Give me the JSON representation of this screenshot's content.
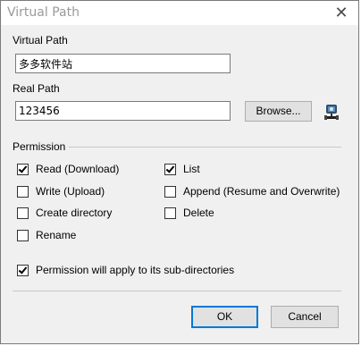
{
  "window": {
    "title": "Virtual Path",
    "close_glyph": "✕"
  },
  "virtual_path": {
    "label": "Virtual Path",
    "value": "多多软件站"
  },
  "real_path": {
    "label": "Real Path",
    "value": "123456",
    "browse_label": "Browse...",
    "browse_icon": "network-folder-icon"
  },
  "permission": {
    "group_label": "Permission",
    "read": {
      "label": "Read (Download)",
      "checked": true
    },
    "list": {
      "label": "List",
      "checked": true
    },
    "write": {
      "label": "Write (Upload)",
      "checked": false
    },
    "append": {
      "label": "Append (Resume and Overwrite)",
      "checked": false
    },
    "create_dir": {
      "label": "Create directory",
      "checked": false
    },
    "delete": {
      "label": "Delete",
      "checked": false
    },
    "rename": {
      "label": "Rename",
      "checked": false
    },
    "apply_subdirs": {
      "label": "Permission will apply to its sub-directories",
      "checked": true
    }
  },
  "buttons": {
    "ok": "OK",
    "cancel": "Cancel"
  },
  "colors": {
    "dialog_bg": "#f0f0f0",
    "titlebar_bg": "#ffffff",
    "title_text": "#9a9a9a",
    "default_button_border": "#0078d7"
  }
}
